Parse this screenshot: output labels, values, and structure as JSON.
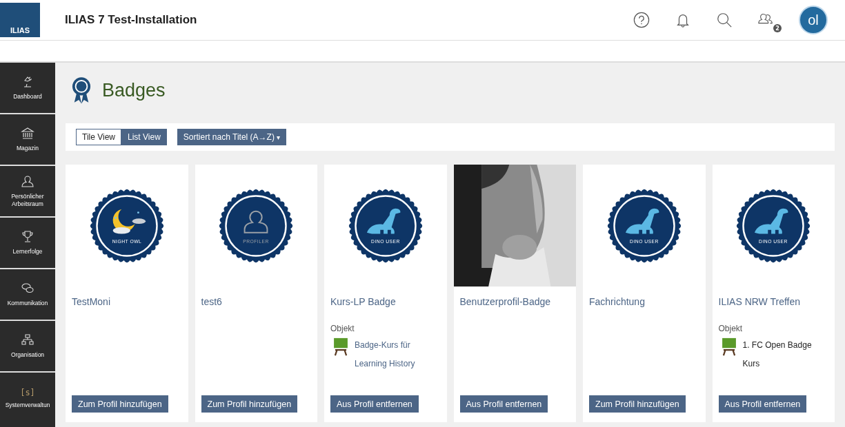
{
  "header": {
    "logo": "ILIAS",
    "title": "ILIAS 7 Test-Installation",
    "contacts_count": "2",
    "avatar": "ol"
  },
  "sidebar": {
    "items": [
      {
        "label": "Dashboard"
      },
      {
        "label": "Magazin"
      },
      {
        "label": "Persönlicher Arbeitsraum"
      },
      {
        "label": "Lernerfolge"
      },
      {
        "label": "Kommunikation"
      },
      {
        "label": "Organisation"
      },
      {
        "label": "Systemverwaltun",
        "icon_text": "[s]"
      }
    ]
  },
  "page": {
    "title": "Badges"
  },
  "toolbar": {
    "views": [
      {
        "label": "Tile View",
        "selected": true
      },
      {
        "label": "List View",
        "selected": false
      }
    ],
    "sort": "Sortiert nach Titel (A→Z)",
    "sort_caret": "▾"
  },
  "cards": [
    {
      "image": {
        "kind": "owl",
        "label": "NIGHT OWL"
      },
      "title": "TestMoni",
      "button": "Zum Profil hinzufügen"
    },
    {
      "image": {
        "kind": "profile",
        "label": "PROFILER"
      },
      "title": "test6",
      "button": "Zum Profil hinzufügen"
    },
    {
      "image": {
        "kind": "dino",
        "label": "DINO USER"
      },
      "title": "Kurs-LP Badge",
      "object": {
        "label": "Objekt",
        "title": "Badge-Kurs für Learning History",
        "link": true
      },
      "button": "Aus Profil entfernen"
    },
    {
      "title": "Benutzerprofil-Badge",
      "button": "Aus Profil entfernen"
    },
    {
      "image": {
        "kind": "dino",
        "label": "DINO USER"
      },
      "title": "Fachrichtung",
      "button": "Zum Profil hinzufügen"
    },
    {
      "image": {
        "kind": "dino",
        "label": "DINO USER"
      },
      "title": "ILIAS NRW Treffen",
      "object": {
        "label": "Objekt",
        "title": "1. FC Open Badge Kurs",
        "link": false
      },
      "button": "Aus Profil entfernen"
    }
  ]
}
